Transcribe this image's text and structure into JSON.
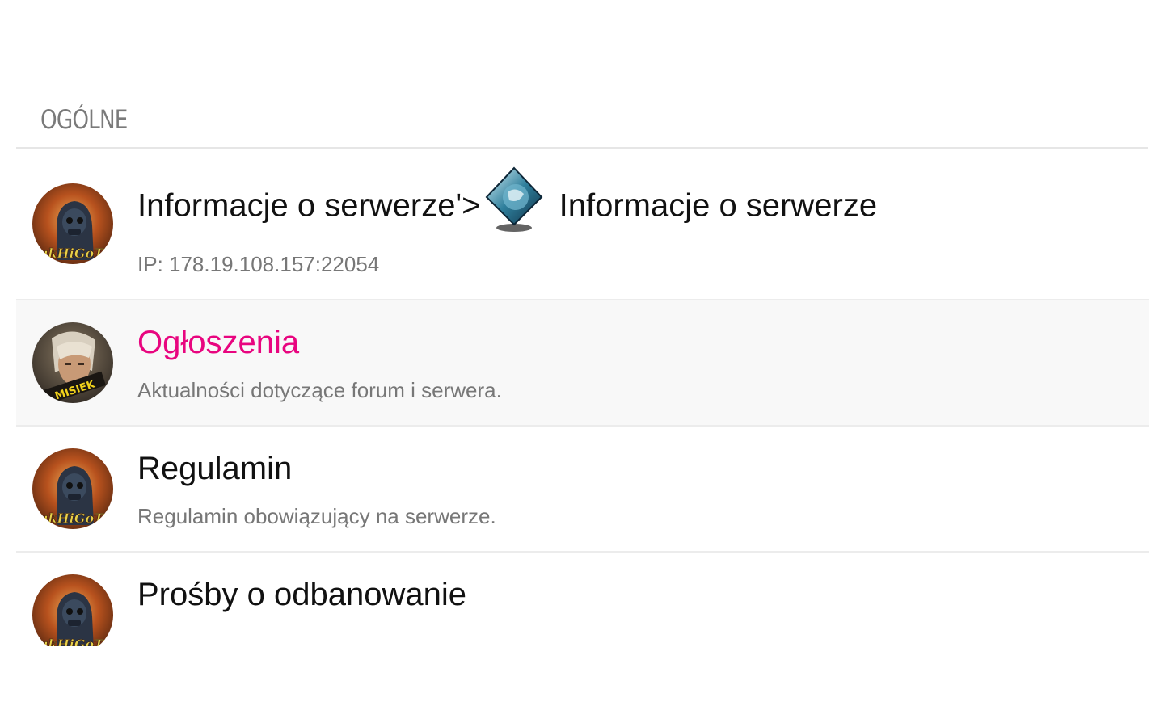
{
  "category": {
    "title": "OGÓLNE"
  },
  "forums": [
    {
      "title_part1": "Informacje o serwerze'>",
      "title_part2": " Informacje o serwerze",
      "description": "IP: 178.19.108.157:22054",
      "avatar_icon": "soldier-avatar-icon",
      "inline_icon": "diamond-emblem-icon"
    },
    {
      "title": "Ogłoszenia",
      "description": "Aktualności dotyczące forum i serwera.",
      "avatar_icon": "misiek-avatar-icon",
      "avatar_label": "MISIEK"
    },
    {
      "title": "Regulamin",
      "description": "Regulamin obowiązujący na serwerze.",
      "avatar_icon": "soldier-avatar-icon"
    },
    {
      "title": "Prośby o odbanowanie",
      "description": "",
      "avatar_icon": "soldier-avatar-icon"
    }
  ],
  "colors": {
    "accent": "#e8057f",
    "title": "#111111",
    "description": "#777777",
    "category_title": "#7a7a7a",
    "row_highlight": "#f8f8f8"
  }
}
